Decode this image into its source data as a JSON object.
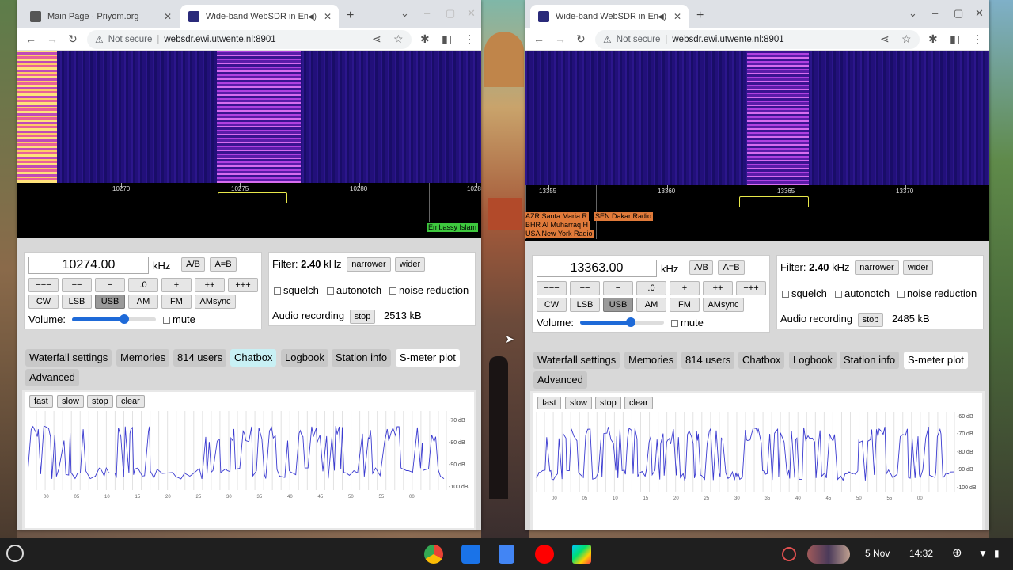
{
  "left_window": {
    "tabs": [
      {
        "title": "Main Page · Priyom.org",
        "active": false
      },
      {
        "title": "Wide-band WebSDR in Ensch",
        "active": true
      }
    ],
    "url_warning": "Not secure",
    "url": "websdr.ewi.utwente.nl:8901",
    "scale_ticks": [
      "10270",
      "10275",
      "10280",
      "1028"
    ],
    "station_labels": [
      "Embassy Islam"
    ],
    "frequency": "10274.00",
    "freq_unit": "kHz",
    "ab_buttons": [
      "A/B",
      "A=B"
    ],
    "step_buttons": [
      "−−−",
      "−−",
      "−",
      ".0",
      "+",
      "++",
      "+++"
    ],
    "modes": [
      "CW",
      "LSB",
      "USB",
      "AM",
      "FM",
      "AMsync"
    ],
    "selected_mode": "USB",
    "volume_label": "Volume:",
    "volume_level": 0.62,
    "mute_label": "mute",
    "filter_label": "Filter:",
    "filter_value": "2.40",
    "filter_unit": "kHz",
    "narrower_label": "narrower",
    "wider_label": "wider",
    "squelch_label": "squelch",
    "autonotch_label": "autonotch",
    "noise_reduction_label": "noise reduction",
    "audio_recording_label": "Audio recording",
    "stop_label": "stop",
    "recording_size": "2513 kB",
    "section_tabs": [
      "Waterfall settings",
      "Memories",
      "814 users",
      "Chatbox",
      "Logbook",
      "Station info",
      "S-meter plot",
      "Advanced"
    ],
    "highlighted_tab": "Chatbox",
    "current_tab": "S-meter plot",
    "plot_buttons": [
      "fast",
      "slow",
      "stop",
      "clear"
    ],
    "db_labels": [
      "-70 dB",
      "-80 dB",
      "-90 dB",
      "-100 dB"
    ],
    "time_labels": [
      "00",
      "05",
      "10",
      "15",
      "20",
      "25",
      "30",
      "35",
      "40",
      "45",
      "50",
      "55",
      "00"
    ]
  },
  "right_window": {
    "tabs": [
      {
        "title": "Wide-band WebSDR in Ensch",
        "active": true
      }
    ],
    "url_warning": "Not secure",
    "url": "websdr.ewi.utwente.nl:8901",
    "scale_ticks": [
      "13355",
      "13360",
      "13365",
      "13370"
    ],
    "station_labels": [
      "AZR Santa Maria R",
      "SEN Dakar Radio",
      "BHR Al Muharraq H",
      "USA New York Radio"
    ],
    "frequency": "13363.00",
    "freq_unit": "kHz",
    "ab_buttons": [
      "A/B",
      "A=B"
    ],
    "step_buttons": [
      "−−−",
      "−−",
      "−",
      ".0",
      "+",
      "++",
      "+++"
    ],
    "modes": [
      "CW",
      "LSB",
      "USB",
      "AM",
      "FM",
      "AMsync"
    ],
    "selected_mode": "USB",
    "volume_label": "Volume:",
    "volume_level": 0.6,
    "mute_label": "mute",
    "filter_label": "Filter:",
    "filter_value": "2.40",
    "filter_unit": "kHz",
    "narrower_label": "narrower",
    "wider_label": "wider",
    "squelch_label": "squelch",
    "autonotch_label": "autonotch",
    "noise_reduction_label": "noise reduction",
    "audio_recording_label": "Audio recording",
    "stop_label": "stop",
    "recording_size": "2485 kB",
    "section_tabs": [
      "Waterfall settings",
      "Memories",
      "814 users",
      "Chatbox",
      "Logbook",
      "Station info",
      "S-meter plot",
      "Advanced"
    ],
    "current_tab": "S-meter plot",
    "plot_buttons": [
      "fast",
      "slow",
      "stop",
      "clear"
    ],
    "db_labels": [
      "-60 dB",
      "-70 dB",
      "-80 dB",
      "-90 dB",
      "-100 dB"
    ],
    "time_labels": [
      "00",
      "05",
      "10",
      "15",
      "20",
      "25",
      "30",
      "35",
      "40",
      "45",
      "50",
      "55",
      "00"
    ]
  },
  "taskbar": {
    "apps": [
      "Chrome",
      "Files",
      "Docs",
      "YouTube",
      "Play Store"
    ],
    "date": "5 Nov",
    "time": "14:32"
  },
  "colors": {
    "waterfall_bg": "#1b0e6e",
    "signal": "#d86cf0",
    "plot_line": "#3a3ad0",
    "filter_marker": "#e8e84a",
    "station_green": "#3ec83e",
    "station_orange": "#e07a3a"
  }
}
